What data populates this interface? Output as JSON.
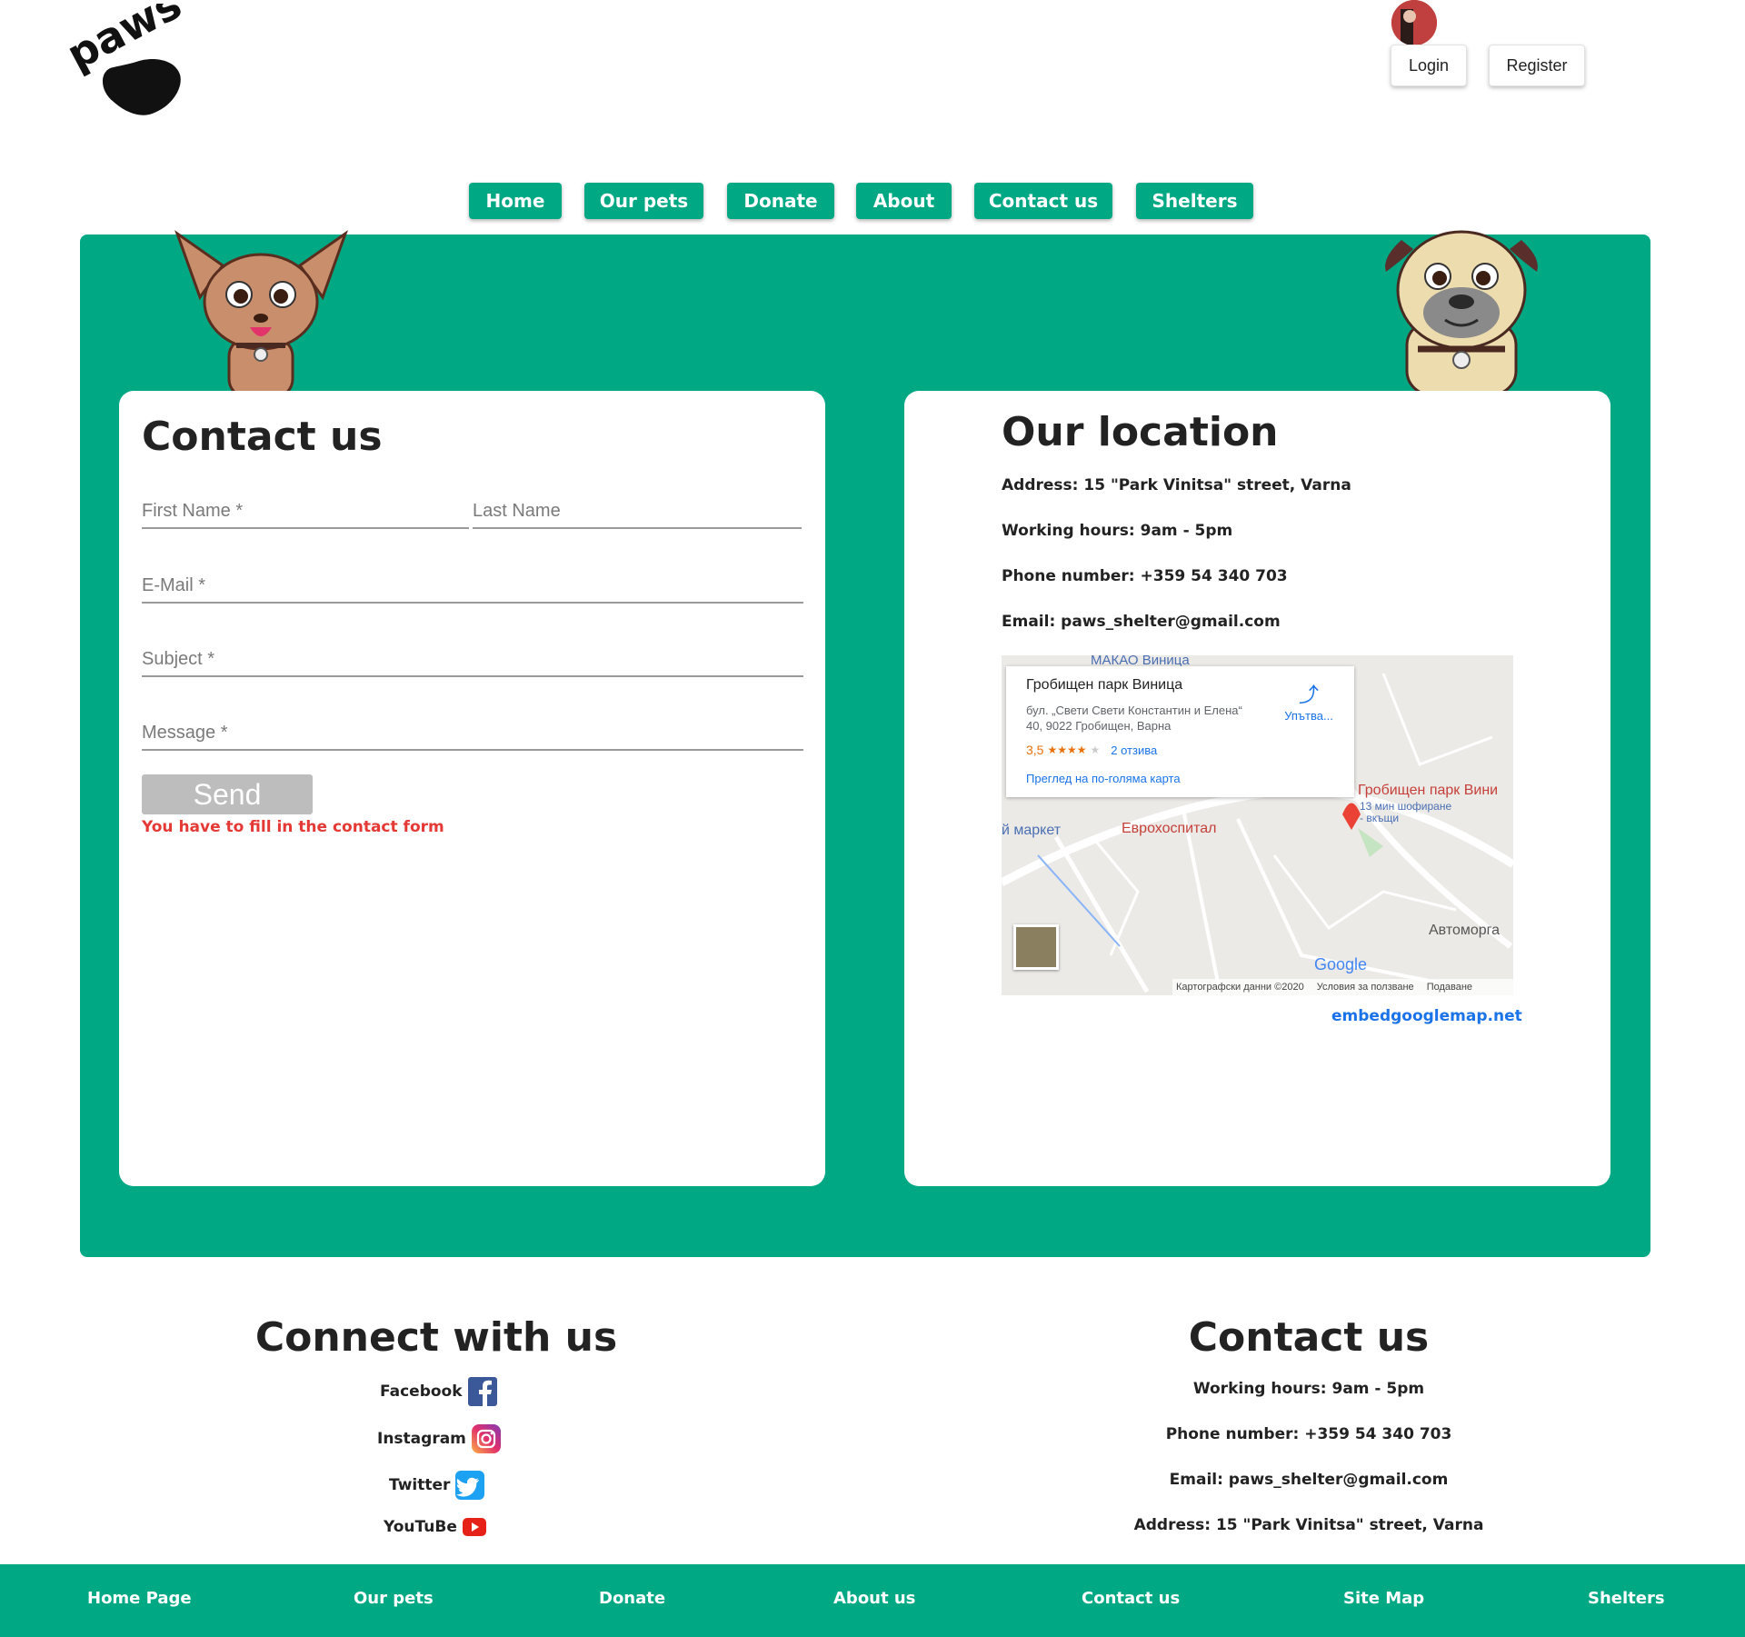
{
  "brand": {
    "logo_text": "paws"
  },
  "auth": {
    "login": "Login",
    "register": "Register"
  },
  "nav": [
    "Home",
    "Our pets",
    "Donate",
    "About",
    "Contact us",
    "Shelters"
  ],
  "contact_form": {
    "title": "Contact us",
    "first_name_placeholder": "First Name *",
    "last_name_placeholder": "Last Name",
    "email_placeholder": "E-Mail *",
    "subject_placeholder": "Subject *",
    "message_placeholder": "Message *",
    "send_label": "Send",
    "error_text": "You have to fill in the contact form"
  },
  "location": {
    "title": "Our location",
    "address": "Address: 15 \"Park Vinitsa\" street, Varna",
    "hours": "Working hours: 9am - 5pm",
    "phone": "Phone number: +359 54 340 703",
    "email": "Email: paws_shelter@gmail.com",
    "map_link": "embedgooglemap.net"
  },
  "map": {
    "place_name": "Гробищен парк Виница",
    "place_address": "бул. „Свети Свети Константин и Елена“ 40, 9022 Гробищен, Варна",
    "rating": "3,5",
    "reviews": "2 отзива",
    "directions": "Упътва...",
    "larger_map": "Преглед на по-голяма карта",
    "label_top": "МАКАО Виница",
    "label_market": "й маркет",
    "label_hospital": "Еврохоспитал",
    "label_pin": "Гробищен парк Вини",
    "label_drive": "13 мин шофиране",
    "label_home": "- вкъщи",
    "label_automorga": "Автоморга",
    "google": "Google",
    "map_data": "Картографски данни ©2020",
    "terms": "Условия за ползване",
    "report": "Подаване"
  },
  "connect": {
    "title": "Connect with us",
    "items": [
      {
        "label": "Facebook",
        "icon": "facebook-icon"
      },
      {
        "label": "Instagram",
        "icon": "instagram-icon"
      },
      {
        "label": "Twitter",
        "icon": "twitter-icon"
      },
      {
        "label": "YouTuBe",
        "icon": "youtube-icon"
      }
    ]
  },
  "footer_contact": {
    "title": "Contact us",
    "hours": "Working hours: 9am - 5pm",
    "phone": "Phone number: +359 54 340 703",
    "email": "Email: paws_shelter@gmail.com",
    "address": "Address: 15 \"Park Vinitsa\" street, Varna"
  },
  "footer_links": [
    "Home Page",
    "Our pets",
    "Donate",
    "About us",
    "Contact us",
    "Site Map",
    "Shelters"
  ],
  "colors": {
    "accent": "#00a884",
    "error": "#e53935",
    "link": "#1a73e8"
  }
}
